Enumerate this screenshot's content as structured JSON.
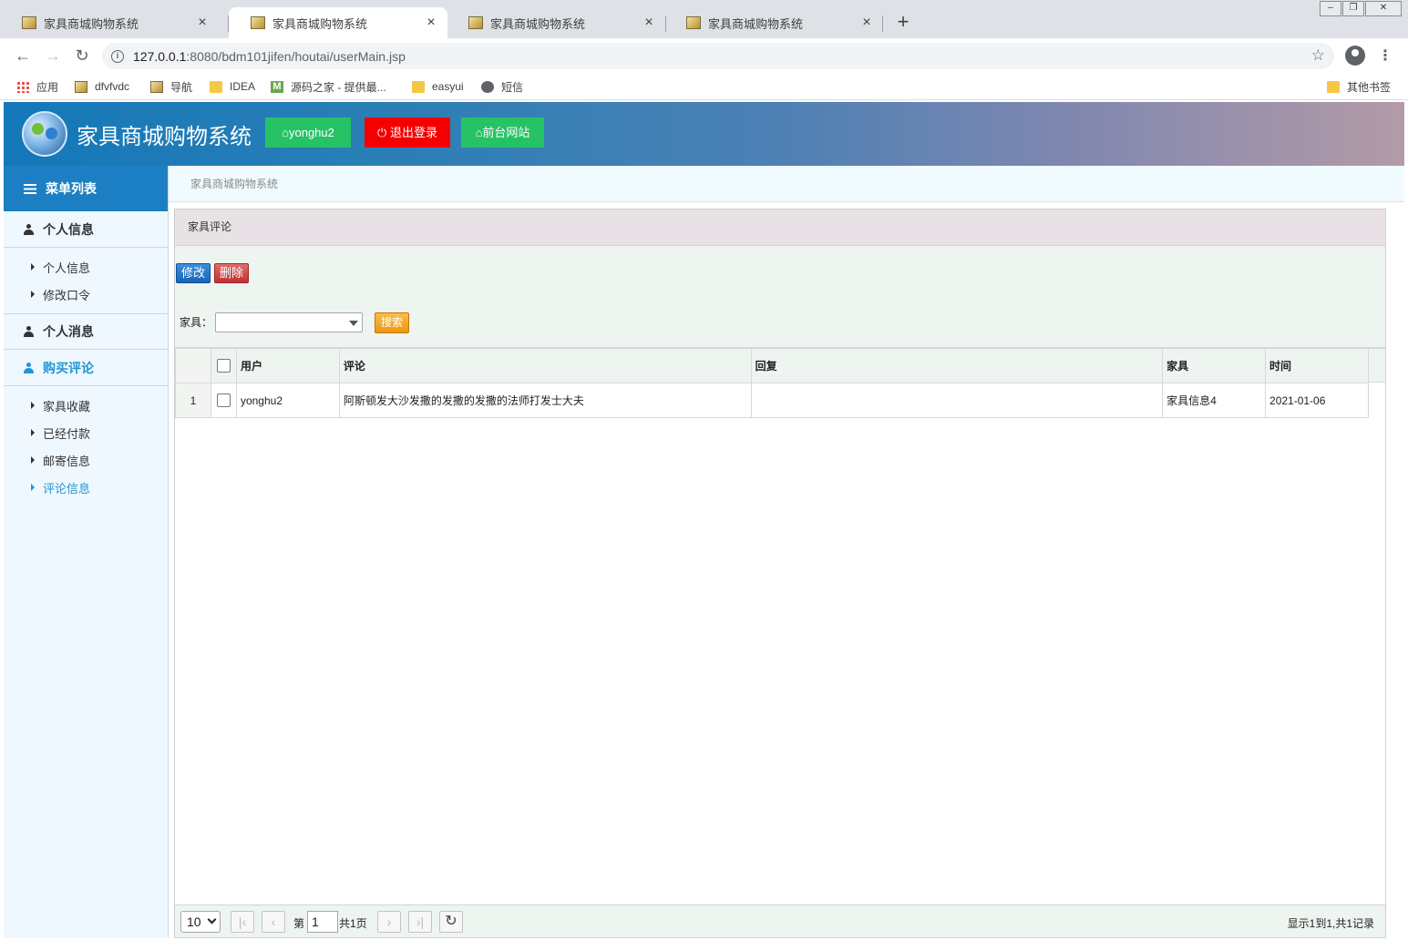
{
  "browser": {
    "tabs": [
      {
        "title": "家具商城购物系统",
        "active": false
      },
      {
        "title": "家具商城购物系统",
        "active": true
      },
      {
        "title": "家具商城购物系统",
        "active": false
      },
      {
        "title": "家具商城购物系统",
        "active": false
      }
    ],
    "url_host": "127.0.0.1",
    "url_path": ":8080/bdm101jifen/houtai/userMain.jsp",
    "bookmarks": [
      "应用",
      "dfvfvdc",
      "导航",
      "IDEA",
      "源码之家 - 提供最...",
      "easyui",
      "短信",
      "其他书签"
    ]
  },
  "header": {
    "title": "家具商城购物系统",
    "user_button": "yonghu2",
    "logout_button": "退出登录",
    "frontend_button": "前台网站"
  },
  "sidebar": {
    "title": "菜单列表",
    "groups": [
      {
        "label": "个人信息",
        "items": [
          "个人信息",
          "修改口令"
        ]
      },
      {
        "label": "个人消息",
        "items": []
      },
      {
        "label": "购买评论",
        "items": [
          "家具收藏",
          "已经付款",
          "邮寄信息",
          "评论信息"
        ]
      }
    ]
  },
  "breadcrumb": "家具商城购物系统",
  "panel": {
    "title": "家具评论",
    "edit_button": "修改",
    "delete_button": "删除",
    "search_label": "家具：",
    "search_value": "",
    "search_button": "搜索"
  },
  "table": {
    "columns": [
      "用户",
      "评论",
      "回复",
      "家具",
      "时间"
    ],
    "rows": [
      {
        "num": "1",
        "user": "yonghu2",
        "comment": "阿斯顿发大沙发撒的发撒的发撒的法师打发士大夫",
        "reply": "",
        "furniture": "家具信息4",
        "time": "2021-01-06"
      }
    ]
  },
  "pager": {
    "page_size": "10",
    "page_prefix": "第",
    "current_page": "1",
    "total_pages": "共1页",
    "summary": "显示1到1,共1记录"
  },
  "colors": {
    "menu_header": "#1d7fc3",
    "green_button": "#26c266",
    "red_button": "#f40000",
    "active_menu": "#2196d3"
  }
}
